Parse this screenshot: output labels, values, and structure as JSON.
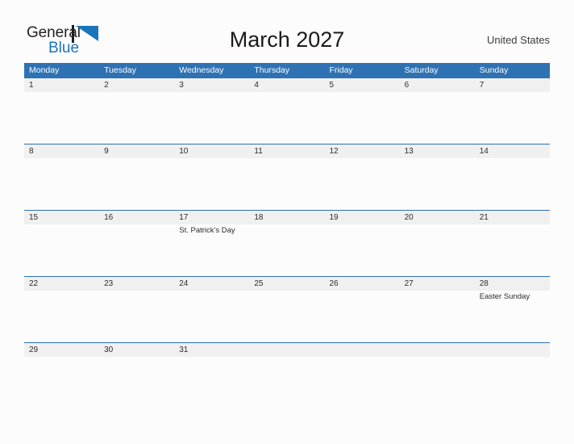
{
  "brand": {
    "word_one": "General",
    "word_two": "Blue",
    "mark_icon": "blue-flag-triangle-icon",
    "color_dark": "#231f20",
    "color_blue": "#1b75bb"
  },
  "header": {
    "title": "March 2027",
    "region": "United States"
  },
  "calendar": {
    "month": "March",
    "year": "2027",
    "header_color": "#2e72b3",
    "date_band_color": "#f0f0f0",
    "weekday_headers": [
      "Monday",
      "Tuesday",
      "Wednesday",
      "Thursday",
      "Friday",
      "Saturday",
      "Sunday"
    ],
    "weeks": [
      {
        "dates": [
          "1",
          "2",
          "3",
          "4",
          "5",
          "6",
          "7"
        ],
        "events": [
          "",
          "",
          "",
          "",
          "",
          "",
          ""
        ]
      },
      {
        "dates": [
          "8",
          "9",
          "10",
          "11",
          "12",
          "13",
          "14"
        ],
        "events": [
          "",
          "",
          "",
          "",
          "",
          "",
          ""
        ]
      },
      {
        "dates": [
          "15",
          "16",
          "17",
          "18",
          "19",
          "20",
          "21"
        ],
        "events": [
          "",
          "",
          "St. Patrick's Day",
          "",
          "",
          "",
          ""
        ]
      },
      {
        "dates": [
          "22",
          "23",
          "24",
          "25",
          "26",
          "27",
          "28"
        ],
        "events": [
          "",
          "",
          "",
          "",
          "",
          "",
          "Easter Sunday"
        ]
      },
      {
        "dates": [
          "29",
          "30",
          "31",
          "",
          "",
          "",
          ""
        ],
        "events": [
          "",
          "",
          "",
          "",
          "",
          "",
          ""
        ]
      }
    ]
  }
}
